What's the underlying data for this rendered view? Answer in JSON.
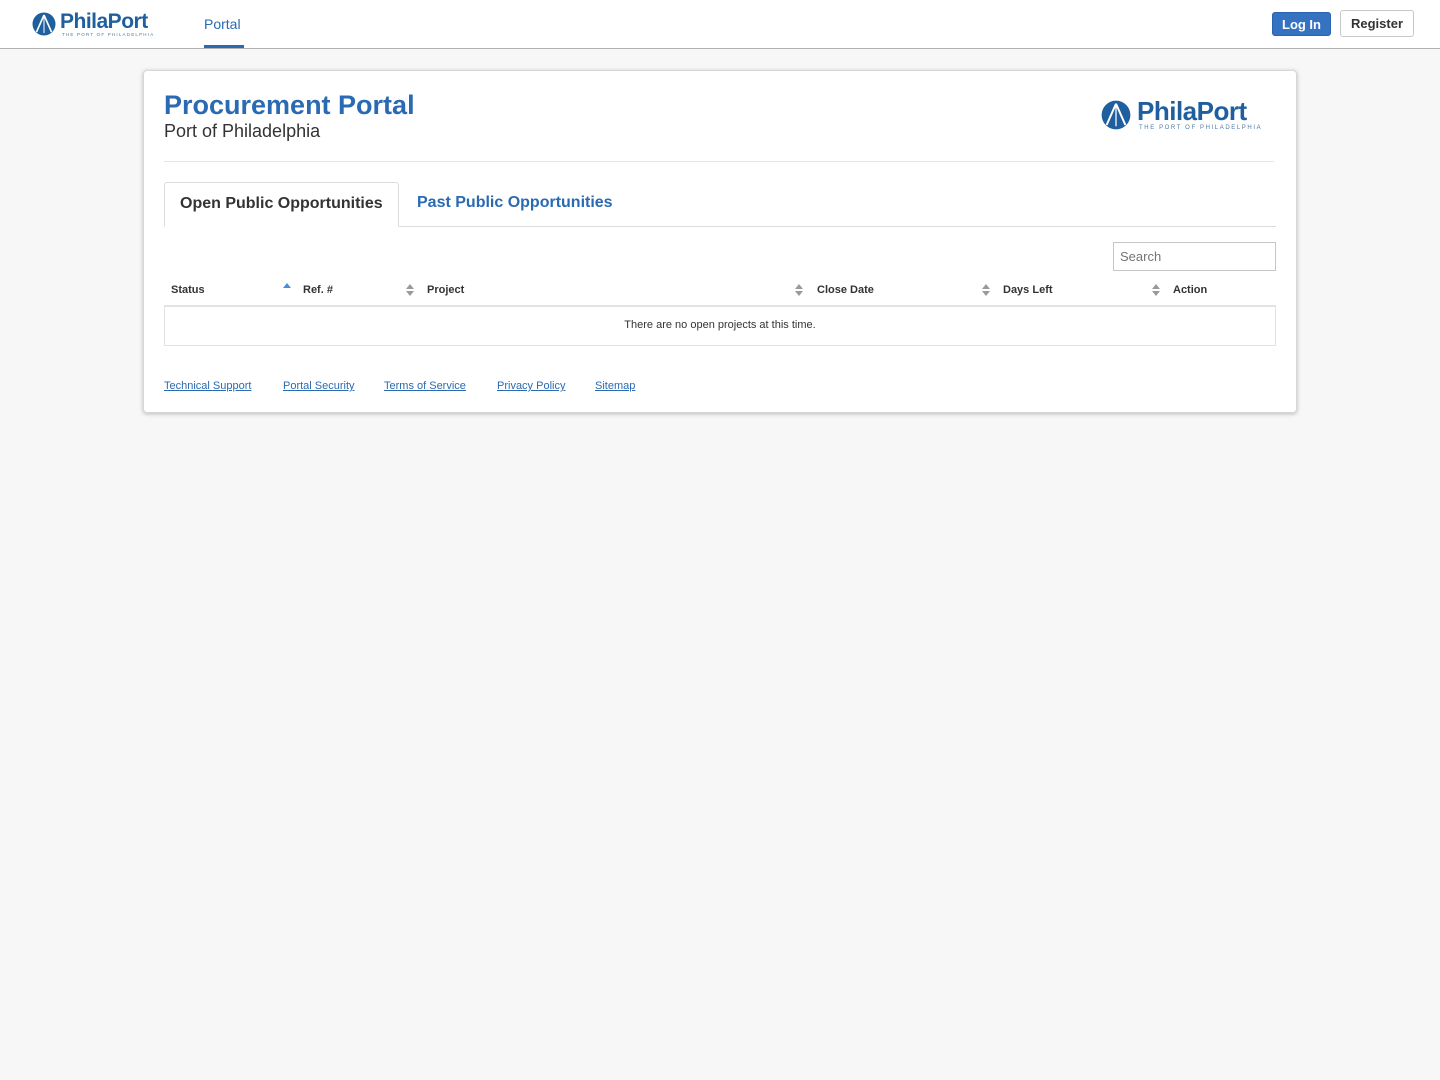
{
  "topnav": {
    "logo": {
      "word": "PhilaPort",
      "tagline": "The Port of Philadelphia",
      "icon": "philaport-logo-icon"
    },
    "nav_items": [
      {
        "label": "Portal",
        "active": true
      }
    ],
    "login_label": "Log In",
    "register_label": "Register"
  },
  "header": {
    "title": "Procurement Portal",
    "subtitle": "Port of Philadelphia",
    "logo": {
      "word": "PhilaPort",
      "tagline": "The Port of Philadelphia",
      "icon": "philaport-logo-icon"
    }
  },
  "tabs": [
    {
      "label": "Open Public Opportunities",
      "active": true
    },
    {
      "label": "Past Public Opportunities",
      "active": false
    }
  ],
  "table": {
    "search_placeholder": "Search",
    "columns": [
      {
        "label": "Status",
        "sort": "ascending"
      },
      {
        "label": "Ref. #",
        "sort": "none"
      },
      {
        "label": "Project",
        "sort": "none"
      },
      {
        "label": "Close Date",
        "sort": "none"
      },
      {
        "label": "Days Left",
        "sort": "none"
      },
      {
        "label": "Action",
        "sort": "none"
      }
    ],
    "empty_message": "There are no open projects at this time."
  },
  "footer_links": [
    "Technical Support",
    "Portal Security",
    "Terms of Service",
    "Privacy Policy",
    "Sitemap"
  ],
  "colors": {
    "brand_blue": "#2a6ab3",
    "button_blue": "#3672c2",
    "background": "#f7f7f7"
  }
}
